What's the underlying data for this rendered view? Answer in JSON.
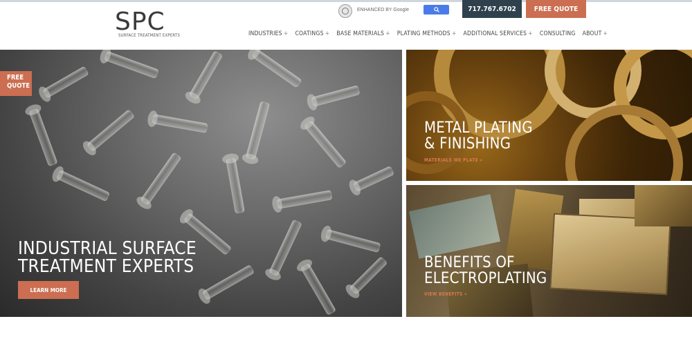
{
  "brand": {
    "logo_mark": "SPC",
    "tagline": "SURFACE TREATMENT EXPERTS"
  },
  "search": {
    "placeholder": "ENHANCED BY Google",
    "button_icon": "magnifier-icon"
  },
  "header": {
    "phone": "717.767.6702",
    "quote_label": "FREE QUOTE"
  },
  "nav": {
    "plus": "+",
    "items": [
      {
        "label": "INDUSTRIES"
      },
      {
        "label": "COATINGS"
      },
      {
        "label": "BASE MATERIALS"
      },
      {
        "label": "PLATING METHODS"
      },
      {
        "label": "ADDITIONAL SERVICES"
      },
      {
        "label": "CONSULTING"
      },
      {
        "label": "ABOUT"
      }
    ]
  },
  "side_tab": {
    "line1": "FREE",
    "line2": "QUOTE"
  },
  "hero": {
    "title_line1": "INDUSTRIAL SURFACE",
    "title_line2": "TREATMENT EXPERTS",
    "button": "LEARN MORE"
  },
  "cards": [
    {
      "title_line1": "METAL PLATING",
      "title_line2": "& FINISHING",
      "link": "MATERIALS WE PLATE »"
    },
    {
      "title_line1": "BENEFITS OF",
      "title_line2": "ELECTROPLATING",
      "link": "VIEW BENEFITS »"
    }
  ],
  "colors": {
    "accent": "#cc6e51",
    "navy": "#2f414c",
    "search_blue": "#4a7ce9",
    "link_orange": "#d9794f"
  }
}
